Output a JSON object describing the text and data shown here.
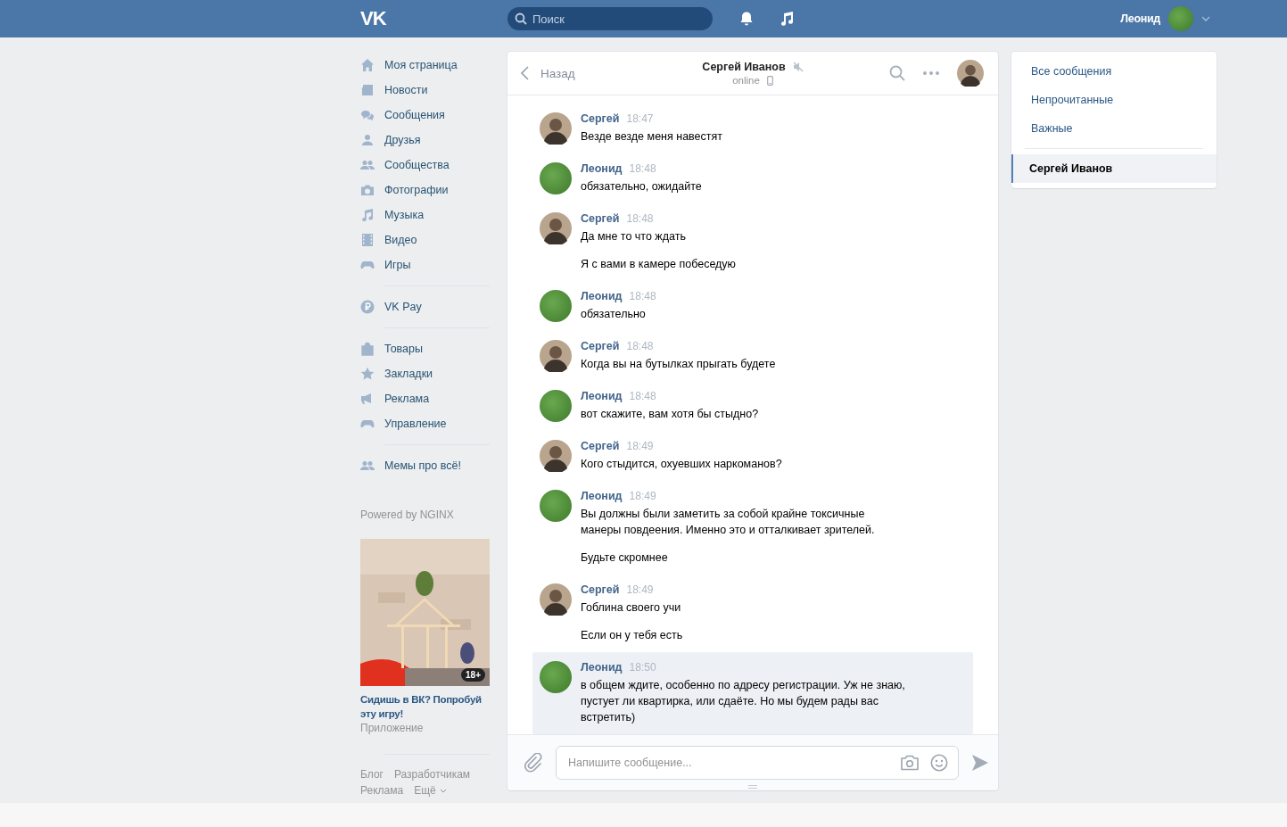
{
  "topbar": {
    "logo": "VK",
    "search": {
      "placeholder": "Поиск"
    },
    "user": {
      "name": "Леонид"
    }
  },
  "sidebar": {
    "groups": [
      [
        {
          "label": "Моя страница"
        },
        {
          "label": "Новости"
        },
        {
          "label": "Сообщения"
        },
        {
          "label": "Друзья"
        },
        {
          "label": "Сообщества"
        },
        {
          "label": "Фотографии"
        },
        {
          "label": "Музыка"
        },
        {
          "label": "Видео"
        },
        {
          "label": "Игры"
        }
      ],
      [
        {
          "label": "VK Pay"
        }
      ],
      [
        {
          "label": "Товары"
        },
        {
          "label": "Закладки"
        },
        {
          "label": "Реклама"
        },
        {
          "label": "Управление"
        }
      ],
      [
        {
          "label": "Мемы про всё!"
        }
      ]
    ],
    "powered": "Powered by NGINX",
    "ad": {
      "badge": "18+",
      "title": "Сидишь в ВК? Попробуй эту игру!",
      "subtitle": "Приложение"
    },
    "footer_links": [
      "Блог",
      "Разработчикам",
      "Реклама",
      "Ещё"
    ]
  },
  "chat": {
    "back": "Назад",
    "title": "Сергей Иванов",
    "muted": true,
    "status": "online",
    "on_mobile": true,
    "messages": [
      {
        "author": "Сергей",
        "kind": "person",
        "time": "18:47",
        "highlighted": false,
        "texts": [
          "Везде везде меня навестят"
        ]
      },
      {
        "author": "Леонид",
        "kind": "green",
        "time": "18:48",
        "highlighted": false,
        "texts": [
          "обязательно, ожидайте"
        ]
      },
      {
        "author": "Сергей",
        "kind": "person",
        "time": "18:48",
        "highlighted": false,
        "texts": [
          "Да мне то что ждать",
          "Я с вами в камере побеседую"
        ]
      },
      {
        "author": "Леонид",
        "kind": "green",
        "time": "18:48",
        "highlighted": false,
        "texts": [
          "обязательно"
        ]
      },
      {
        "author": "Сергей",
        "kind": "person",
        "time": "18:48",
        "highlighted": false,
        "texts": [
          "Когда вы на бутылках прыгать будете"
        ]
      },
      {
        "author": "Леонид",
        "kind": "green",
        "time": "18:48",
        "highlighted": false,
        "texts": [
          "вот скажите, вам хотя бы стыдно?"
        ]
      },
      {
        "author": "Сергей",
        "kind": "person",
        "time": "18:49",
        "highlighted": false,
        "texts": [
          "Кого стыдится, охуевших наркоманов?"
        ]
      },
      {
        "author": "Леонид",
        "kind": "green",
        "time": "18:49",
        "highlighted": false,
        "texts": [
          "Вы должны были заметить за собой крайне токсичные манеры повдеения. Именно это и отталкивает зрителей.",
          "Будьте скромнее"
        ]
      },
      {
        "author": "Сергей",
        "kind": "person",
        "time": "18:49",
        "highlighted": false,
        "texts": [
          "Гоблина своего учи",
          "Если он у тебя есть"
        ]
      },
      {
        "author": "Леонид",
        "kind": "green",
        "time": "18:50",
        "highlighted": true,
        "texts": [
          "в общем ждите, особенно по адресу регистрации. Уж не знаю, пустует ли квартирка, или сдаёте. Но мы будем рады вас встретить)"
        ]
      }
    ],
    "input": {
      "placeholder": "Напишите сообщение..."
    }
  },
  "right_panel": {
    "filters": [
      {
        "label": "Все сообщения",
        "selected": false
      },
      {
        "label": "Непрочитанные",
        "selected": false
      },
      {
        "label": "Важные",
        "selected": false
      }
    ],
    "conversations": [
      {
        "label": "Сергей Иванов",
        "selected": true
      }
    ]
  }
}
